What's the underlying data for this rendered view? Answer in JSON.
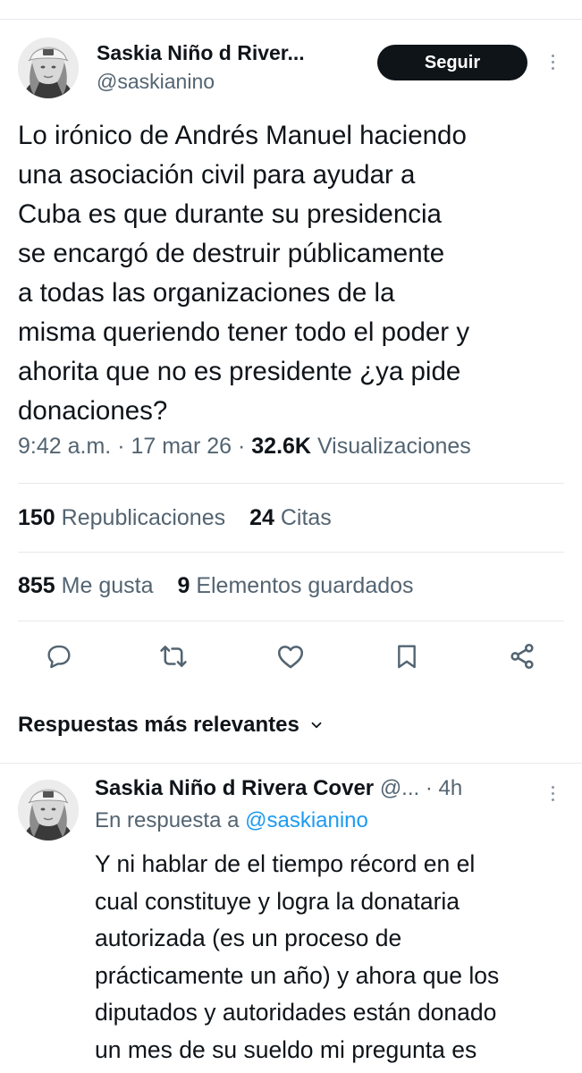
{
  "tweet": {
    "author": {
      "name": "Saskia Niño d River...",
      "handle": "@saskianino"
    },
    "follow_label": "Seguir",
    "text": "Lo irónico de Andrés Manuel haciendo\nuna asociación civil para ayudar a\nCuba es que durante su presidencia\nse encargó de destruir públicamente\na todas las organizaciones de la\nmisma queriendo tener todo el poder y\nahorita que no es presidente ¿ya pide\ndonaciones?",
    "time": "9:42 a.m.",
    "separator": "·",
    "date": "17 mar 26",
    "views_count": "32.6K",
    "views_label": "Visualizaciones"
  },
  "stats": {
    "reposts": {
      "count": "150",
      "label": "Republicaciones"
    },
    "quotes": {
      "count": "24",
      "label": "Citas"
    },
    "likes": {
      "count": "855",
      "label": "Me gusta"
    },
    "bookmarks": {
      "count": "9",
      "label": "Elementos guardados"
    }
  },
  "actions": {
    "icons": [
      "reply-icon",
      "retweet-icon",
      "heart-icon",
      "bookmark-icon",
      "share-icon"
    ]
  },
  "replies": {
    "sort_label": "Respuestas más relevantes",
    "items": [
      {
        "name": "Saskia Niño d Rivera Cover",
        "handle": "@...",
        "separator": "·",
        "time": "4h",
        "in_reply_prefix": "En respuesta a",
        "in_reply_handle": "@saskianino",
        "text": "Y ni hablar de el tiempo récord en el\ncual constituye y logra la donataria\nautorizada (es un proceso de\nprácticamente un año) y ahora que los\ndiputados y autoridades están donado\nun mes de su sueldo mi pregunta es"
      }
    ]
  },
  "colors": {
    "text": "#0f1419",
    "muted": "#536471",
    "link": "#1d9bf0",
    "button_bg": "#0f1419",
    "divider": "#e6e9ec"
  }
}
